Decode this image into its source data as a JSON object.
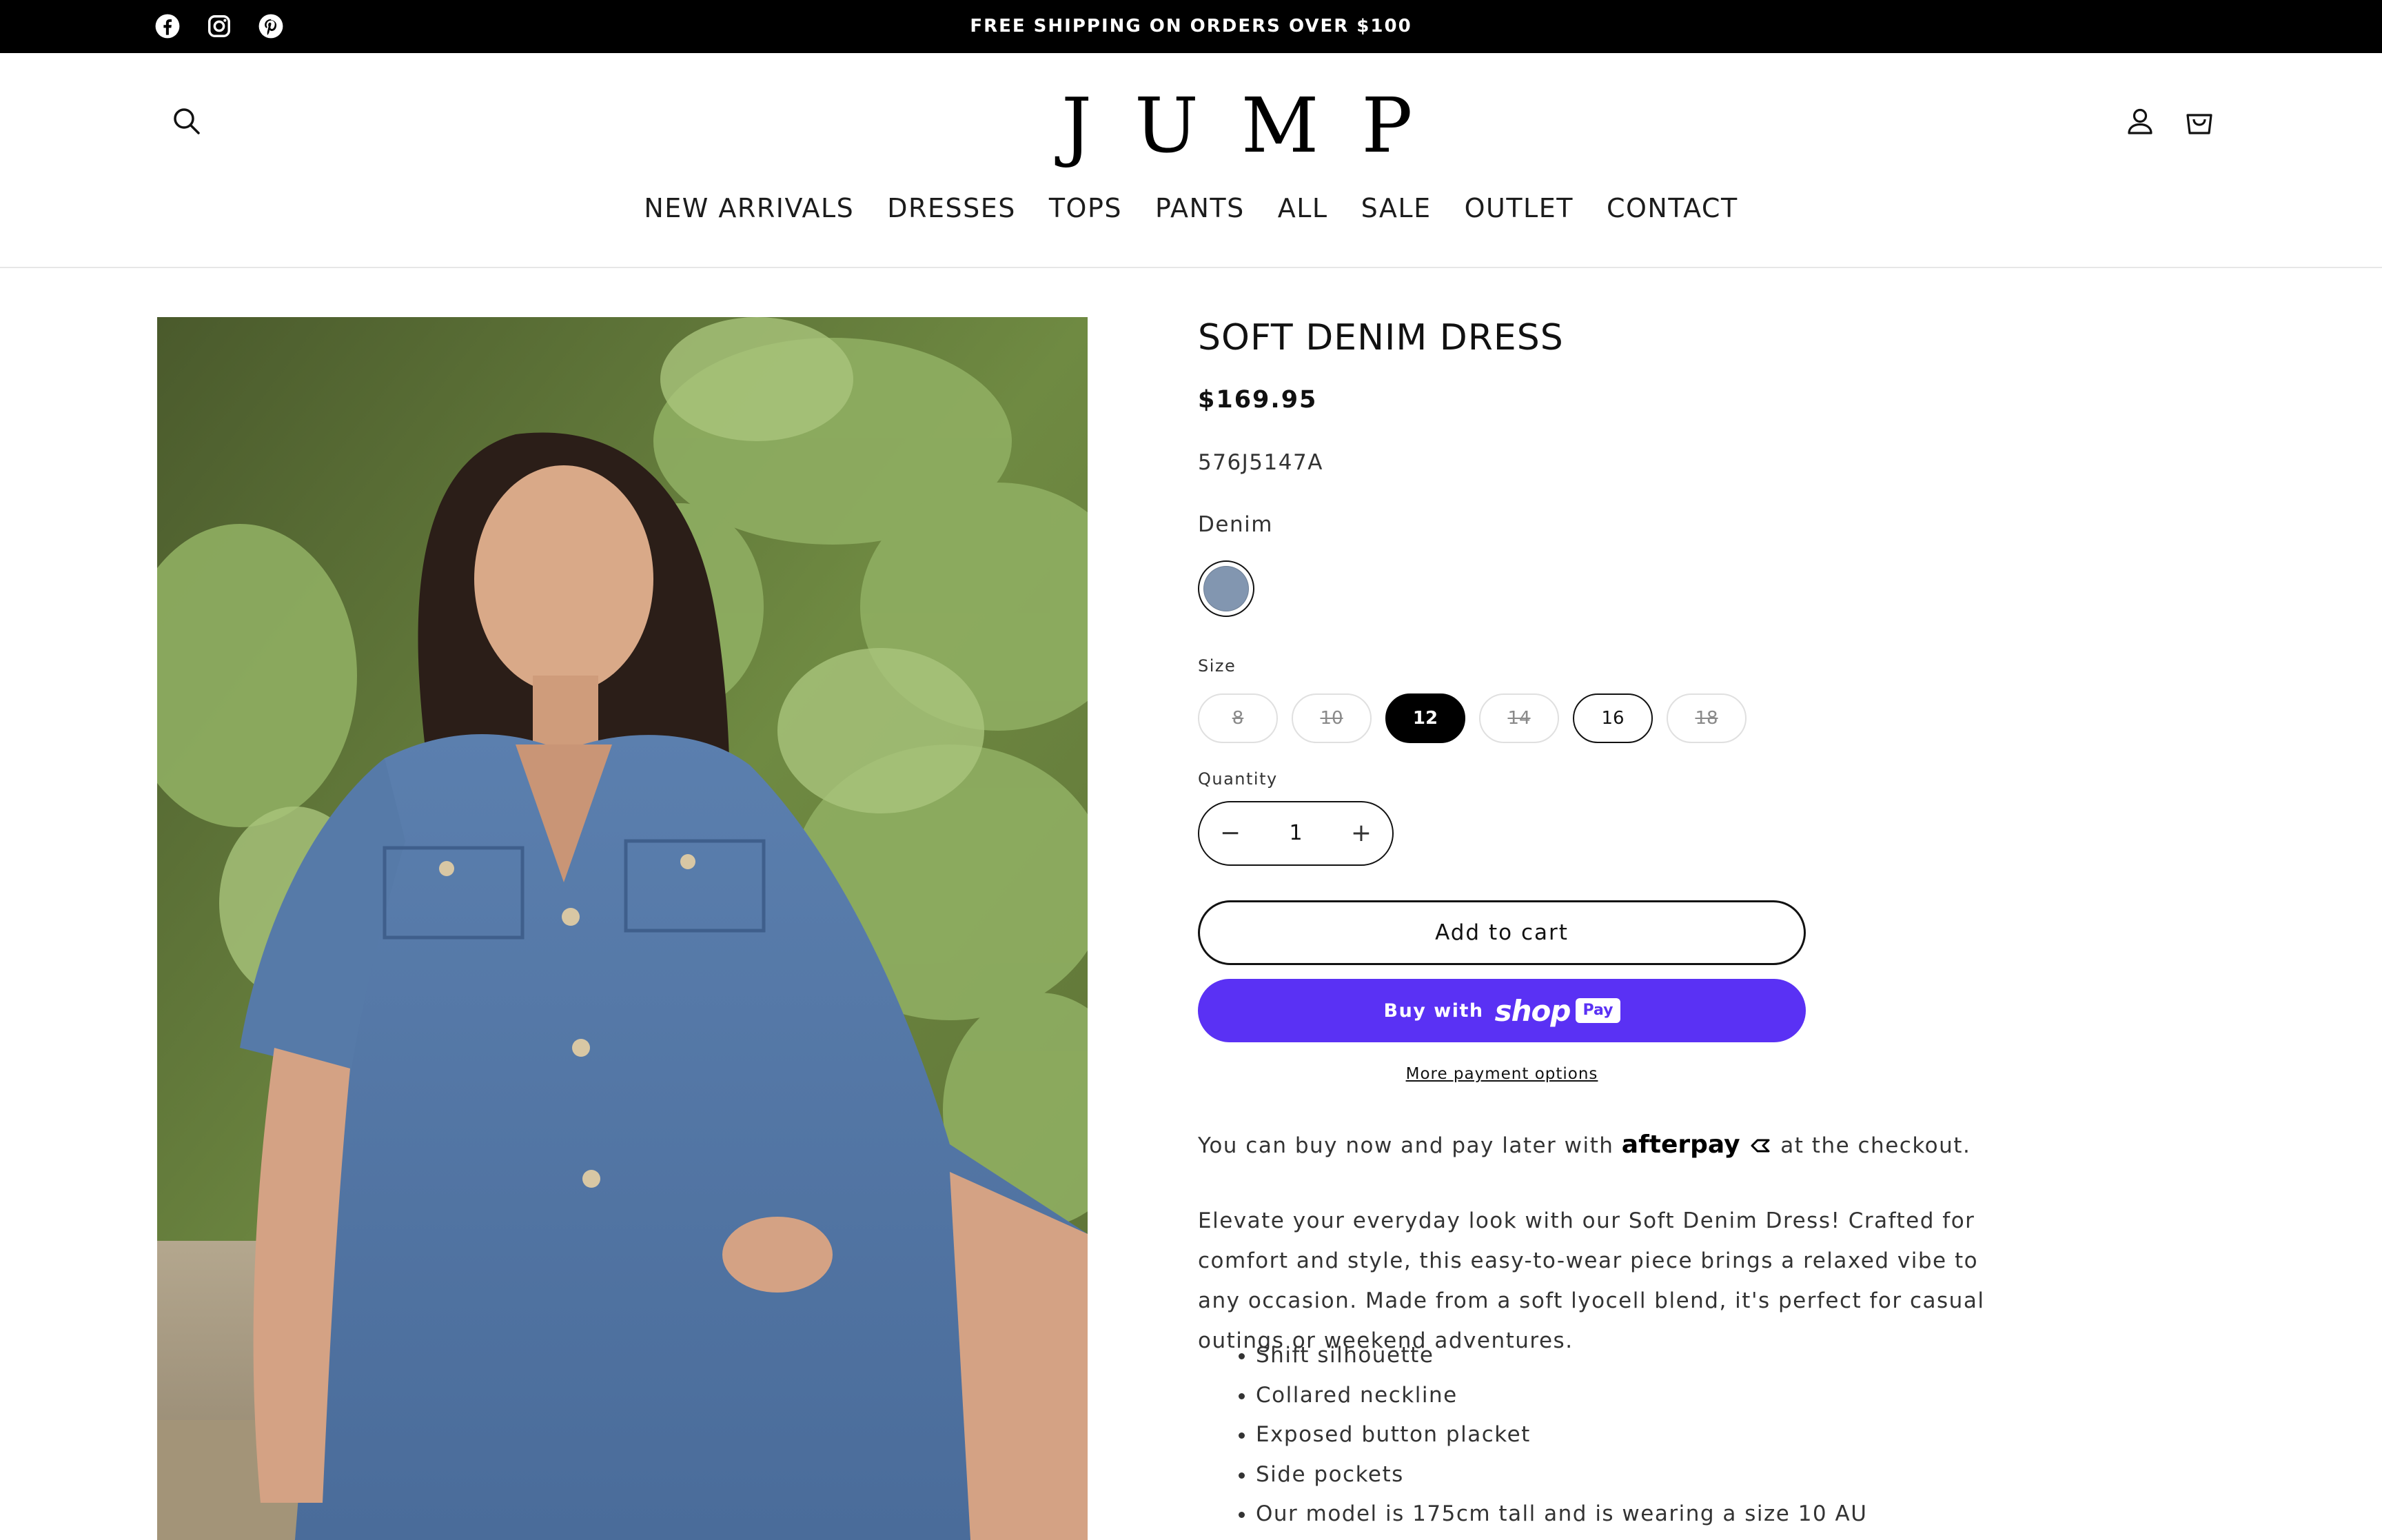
{
  "announcement": {
    "text": "FREE SHIPPING ON ORDERS OVER $100",
    "social_icons": [
      "facebook-icon",
      "instagram-icon",
      "pinterest-icon"
    ]
  },
  "header": {
    "logo": "JUMP",
    "icons": [
      "search-icon",
      "account-icon",
      "cart-icon"
    ]
  },
  "nav": {
    "items": [
      "NEW ARRIVALS",
      "DRESSES",
      "TOPS",
      "PANTS",
      "ALL",
      "SALE",
      "OUTLET",
      "CONTACT"
    ]
  },
  "product": {
    "title": "SOFT DENIM DRESS",
    "price": "$169.95",
    "sku": "576J5147A",
    "color_label": "Denim",
    "color_swatch": "#8296b0",
    "size_label": "Size",
    "sizes": [
      {
        "label": "8",
        "state": "unavailable"
      },
      {
        "label": "10",
        "state": "unavailable"
      },
      {
        "label": "12",
        "state": "selected"
      },
      {
        "label": "14",
        "state": "unavailable"
      },
      {
        "label": "16",
        "state": "available"
      },
      {
        "label": "18",
        "state": "unavailable"
      }
    ],
    "quantity_label": "Quantity",
    "quantity_value": "1",
    "add_to_cart": "Add to cart",
    "buy_with": "Buy with",
    "shop_word": "shop",
    "pay_badge": "Pay",
    "more_payment": "More payment options",
    "afterpay_before": "You can buy now and pay later with",
    "afterpay_brand": "afterpay",
    "afterpay_after": "at the checkout.",
    "description": "Elevate your everyday look with our Soft Denim Dress! Crafted for comfort and style, this easy-to-wear piece brings a relaxed vibe to any occasion. Made from a soft lyocell blend, it's perfect for casual outings or weekend adventures.",
    "features": [
      "Shift silhouette",
      "Collared neckline",
      "Exposed button placket",
      "Side pockets",
      "Our model is 175cm tall and is wearing a size 10 AU"
    ]
  },
  "colors": {
    "accent_shoppay": "#5a31f4",
    "announcement_bg": "#000000"
  }
}
